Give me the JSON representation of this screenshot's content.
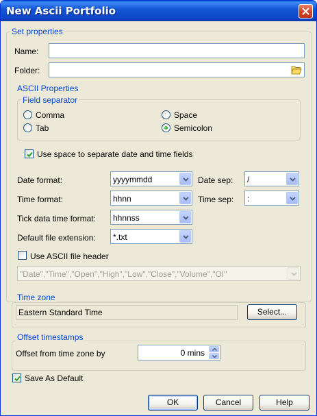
{
  "window": {
    "title": "New Ascii Portfolio"
  },
  "set_properties": {
    "legend": "Set properties",
    "name_label": "Name:",
    "name_value": "",
    "folder_label": "Folder:",
    "folder_value": ""
  },
  "ascii_properties": {
    "legend": "ASCII Properties",
    "field_separator": {
      "legend": "Field separator",
      "options": [
        {
          "label": "Comma",
          "checked": false
        },
        {
          "label": "Space",
          "checked": false
        },
        {
          "label": "Tab",
          "checked": false
        },
        {
          "label": "Semicolon",
          "checked": true
        }
      ]
    },
    "use_space_label": "Use space to separate date and time fields",
    "use_space_checked": true,
    "date_format_label": "Date format:",
    "date_format_value": "yyyymmdd",
    "date_sep_label": "Date sep:",
    "date_sep_value": "/",
    "time_format_label": "Time format:",
    "time_format_value": "hhnn",
    "time_sep_label": "Time sep:",
    "time_sep_value": ":",
    "tick_format_label": "Tick data time format:",
    "tick_format_value": "hhnnss",
    "default_ext_label": "Default file extension:",
    "default_ext_value": "*.txt",
    "use_header_label": "Use ASCII file header",
    "use_header_checked": false,
    "header_value": "\"Date\",\"Time\",\"Open\",\"High\",\"Low\",\"Close\",\"Volume\",\"OI\""
  },
  "time_zone": {
    "legend": "Time zone",
    "value": "Eastern Standard Time",
    "select_label": "Select..."
  },
  "offset": {
    "legend": "Offset timestamps",
    "label": "Offset from time zone by",
    "value": "0 mins"
  },
  "save_default": {
    "label": "Save As Default",
    "checked": true
  },
  "buttons": {
    "ok": "OK",
    "cancel": "Cancel",
    "help": "Help"
  },
  "colors": {
    "titlebar": "#0a46c6",
    "group_legend": "#0046d5",
    "dialog_bg": "#ece9d8"
  },
  "icons": {
    "folder": "folder-open-icon",
    "close": "close-icon"
  }
}
